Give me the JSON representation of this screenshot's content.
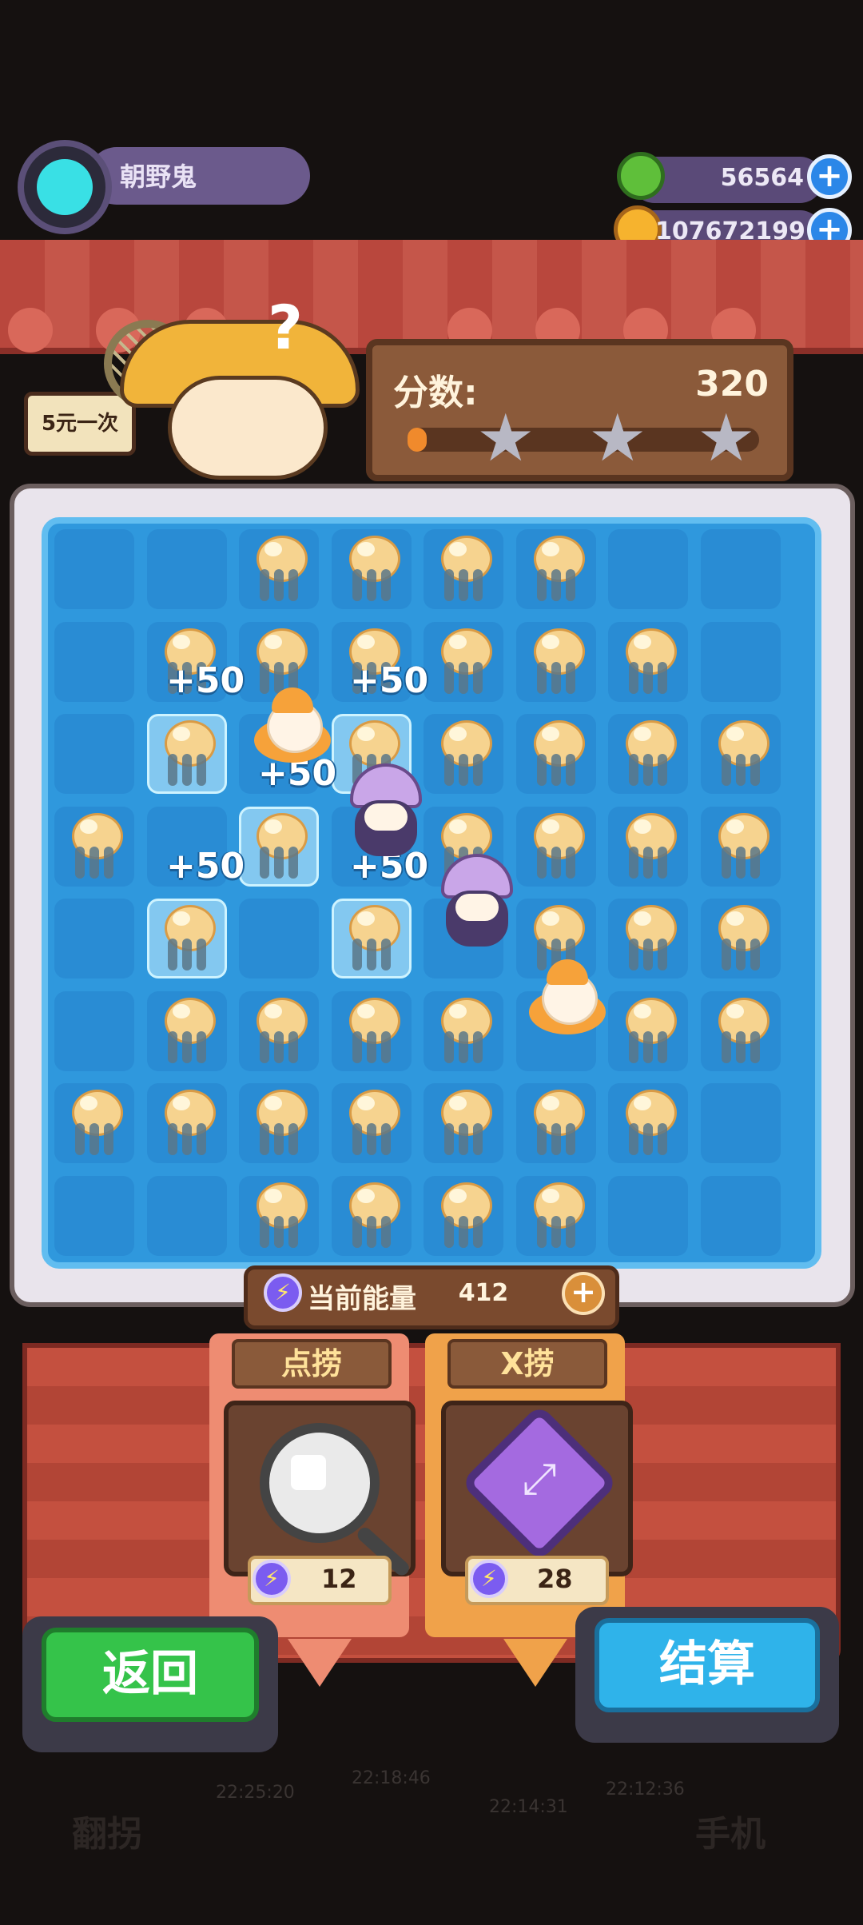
{
  "profile": {
    "name": "朝野鬼"
  },
  "currencies": [
    {
      "icon": "donut-icon",
      "value": "56564",
      "color": "#5fbf3a"
    },
    {
      "icon": "planet-coin-icon",
      "value": "107672199",
      "color": "#f6b32e"
    }
  ],
  "shop_sign": "5元一次",
  "score": {
    "label": "分数:",
    "value": "320",
    "progress": 0.05,
    "stars_total": 3,
    "stars_earned": 0
  },
  "board": {
    "columns": 8,
    "rows": 8,
    "grid": [
      "..JJJJ..",
      ".JJJJJJ.",
      ".J.JJJJJ",
      "J.J.JJJJ",
      ".J.J.JJJ",
      ".JJJJ.JJ",
      "JJJJJJJ.",
      "..JJJJ.."
    ],
    "bonus_labels": [
      {
        "text": "+50"
      },
      {
        "text": "+50"
      },
      {
        "text": "+50"
      },
      {
        "text": "+50"
      },
      {
        "text": "+50"
      }
    ]
  },
  "energy": {
    "label": "当前能量",
    "value": "412"
  },
  "tools": [
    {
      "name": "点捞",
      "cost": "12",
      "icon": "magnifier-net-icon"
    },
    {
      "name": "X捞",
      "cost": "28",
      "icon": "x-net-icon"
    }
  ],
  "buttons": {
    "back": "返回",
    "settle": "结算"
  },
  "background_text": {
    "times": [
      "22:25:20",
      "22:18:46",
      "22:14:31",
      "22:12:36"
    ],
    "labels": [
      "翻拐",
      "手机"
    ]
  }
}
